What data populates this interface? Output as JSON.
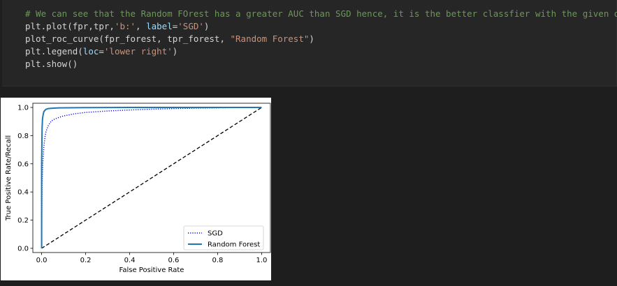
{
  "code_cell": {
    "lines": [
      {
        "type": "comment",
        "text": "# We can see that the Random FOrest has a greater AUC than SGD hence, it is the better classfier with the given data"
      },
      {
        "type": "code",
        "parts": [
          {
            "cls": "txt",
            "text": "plt.plot(fpr,tpr,"
          },
          {
            "cls": "str",
            "text": "'b:'"
          },
          {
            "cls": "txt",
            "text": ", "
          },
          {
            "cls": "kw",
            "text": "label"
          },
          {
            "cls": "txt",
            "text": "="
          },
          {
            "cls": "str",
            "text": "'SGD'"
          },
          {
            "cls": "txt",
            "text": ")"
          }
        ]
      },
      {
        "type": "code",
        "parts": [
          {
            "cls": "txt",
            "text": "plot_roc_curve(fpr_forest, tpr_forest, "
          },
          {
            "cls": "str",
            "text": "\"Random Forest\""
          },
          {
            "cls": "txt",
            "text": ")"
          }
        ]
      },
      {
        "type": "code",
        "parts": [
          {
            "cls": "txt",
            "text": "plt.legend("
          },
          {
            "cls": "kw",
            "text": "loc"
          },
          {
            "cls": "txt",
            "text": "="
          },
          {
            "cls": "str",
            "text": "'lower right'"
          },
          {
            "cls": "txt",
            "text": ")"
          }
        ]
      },
      {
        "type": "code",
        "parts": [
          {
            "cls": "txt",
            "text": "plt.show()"
          }
        ]
      }
    ]
  },
  "chart_data": {
    "type": "line",
    "xlabel": "False Positive Rate",
    "ylabel": "True Positive Rate/Recall",
    "xlim": [
      -0.04,
      1.04
    ],
    "ylim": [
      -0.03,
      1.03
    ],
    "xticks": [
      0.0,
      0.2,
      0.4,
      0.6,
      0.8,
      1.0
    ],
    "xtick_labels": [
      "0.0",
      "0.2",
      "0.4",
      "0.6",
      "0.8",
      "1.0"
    ],
    "yticks": [
      0.0,
      0.2,
      0.4,
      0.6,
      0.8,
      1.0
    ],
    "ytick_labels": [
      "0.0",
      "0.2",
      "0.4",
      "0.6",
      "0.8",
      "1.0"
    ],
    "grid": false,
    "legend_position": "lower-right",
    "series": [
      {
        "name": "SGD",
        "style": "dotted",
        "color": "#0000ff",
        "x": [
          0.0,
          0.002,
          0.005,
          0.01,
          0.015,
          0.02,
          0.03,
          0.04,
          0.05,
          0.07,
          0.1,
          0.15,
          0.2,
          0.3,
          0.4,
          0.5,
          0.6,
          0.7,
          0.8,
          0.9,
          1.0
        ],
        "y": [
          0.0,
          0.45,
          0.6,
          0.72,
          0.79,
          0.83,
          0.87,
          0.895,
          0.91,
          0.925,
          0.94,
          0.955,
          0.965,
          0.975,
          0.982,
          0.988,
          0.992,
          0.995,
          0.997,
          0.999,
          1.0
        ]
      },
      {
        "name": "Random Forest",
        "style": "solid",
        "color": "#1f77b4",
        "x": [
          0.0,
          0.0,
          0.002,
          0.004,
          0.007,
          0.01,
          0.015,
          0.02,
          0.03,
          0.05,
          0.08,
          0.12,
          0.2,
          0.4,
          0.6,
          0.8,
          1.0
        ],
        "y": [
          0.0,
          0.6,
          0.85,
          0.92,
          0.95,
          0.97,
          0.98,
          0.987,
          0.992,
          0.995,
          0.997,
          0.998,
          0.999,
          1.0,
          1.0,
          1.0,
          1.0
        ]
      },
      {
        "style": "dashed",
        "color": "#000000",
        "x": [
          0.0,
          1.0
        ],
        "y": [
          0.0,
          1.0
        ]
      }
    ]
  }
}
